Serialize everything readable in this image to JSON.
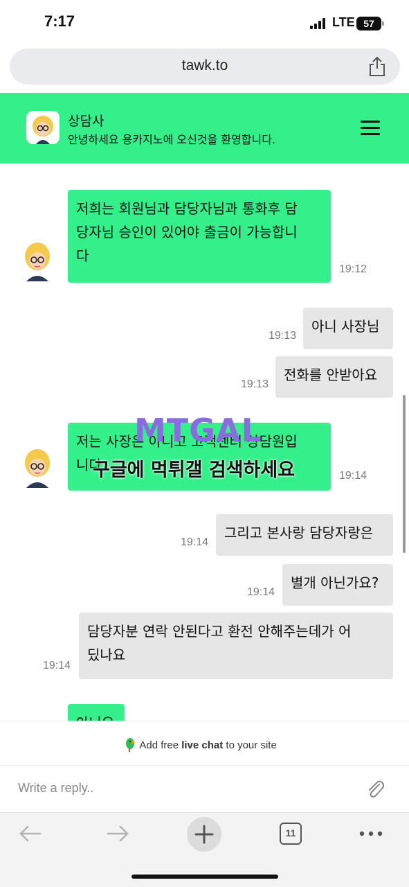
{
  "status_bar": {
    "time": "7:17",
    "network": "LTE",
    "battery": "57"
  },
  "browser": {
    "url": "tawk.to",
    "tab_count": "11"
  },
  "chat_header": {
    "agent_name": "상담사",
    "subtitle": "안녕하세요 용카지노에 오신것을 환영합니다."
  },
  "messages": [
    {
      "sender": "agent",
      "lines": [
        "저희는 회원님과 담당자님과 통화후 담",
        "당자님 승인이 있어야 출금이 가능합니",
        "다"
      ],
      "time": "19:12"
    },
    {
      "sender": "visitor",
      "lines": [
        "아니 사장님"
      ],
      "time": "19:13"
    },
    {
      "sender": "visitor",
      "lines": [
        "전화를 안받아요"
      ],
      "time": "19:13"
    },
    {
      "sender": "agent",
      "lines": [
        "저는 사장은 아니고 고객센터 상담원입",
        "니다"
      ],
      "time": "19:14"
    },
    {
      "sender": "visitor",
      "lines": [
        "그리고 본사랑 담당자랑은"
      ],
      "time": "19:14"
    },
    {
      "sender": "visitor",
      "lines": [
        "별개 아닌가요?"
      ],
      "time": "19:14"
    },
    {
      "sender": "visitor",
      "lines": [
        "담당자분 연락 안된다고 환전 안해주는데가 어",
        "딨나요"
      ],
      "time": "19:14"
    },
    {
      "sender": "agent",
      "lines": [
        "아니요"
      ],
      "time": ""
    }
  ],
  "watermark": {
    "logo": "MTGAL",
    "text": "구글에 먹튀갤 검색하세요"
  },
  "footer": {
    "branding_pre": "Add free ",
    "branding_bold": "live chat",
    "branding_post": " to your site",
    "reply_placeholder": "Write a reply.."
  },
  "colors": {
    "accent": "#34f08a",
    "visitor_bubble": "#e6e6e6"
  },
  "icons": [
    "share-icon",
    "menu-icon",
    "paperclip-icon",
    "back-arrow-icon",
    "forward-arrow-icon",
    "new-tab-plus-icon",
    "tabs-icon",
    "more-icon"
  ]
}
